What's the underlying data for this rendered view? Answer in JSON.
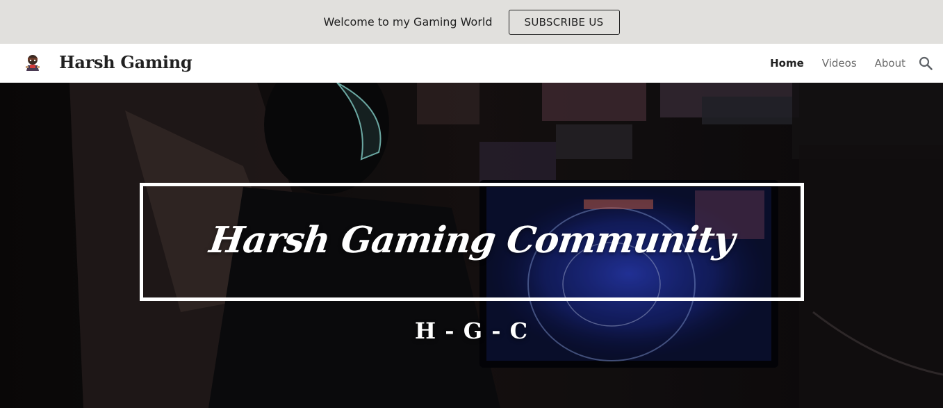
{
  "announcement": {
    "text": "Welcome to my Gaming World",
    "button_label": "SUBSCRIBE US"
  },
  "header": {
    "site_title": "Harsh Gaming",
    "nav": [
      {
        "label": "Home",
        "active": true
      },
      {
        "label": "Videos",
        "active": false
      },
      {
        "label": "About",
        "active": false
      }
    ],
    "search_icon": "search-icon",
    "logo_icon": "gamer-character-logo"
  },
  "hero": {
    "title": "Harsh Gaming Community",
    "subtitle": "H - G - C",
    "background": "dark gaming setup photo"
  },
  "colors": {
    "announce_bg": "#e1e0dd",
    "header_bg": "#ffffff",
    "text_dark": "#212121",
    "nav_muted": "#6b6b6b",
    "hero_text": "#ffffff"
  }
}
